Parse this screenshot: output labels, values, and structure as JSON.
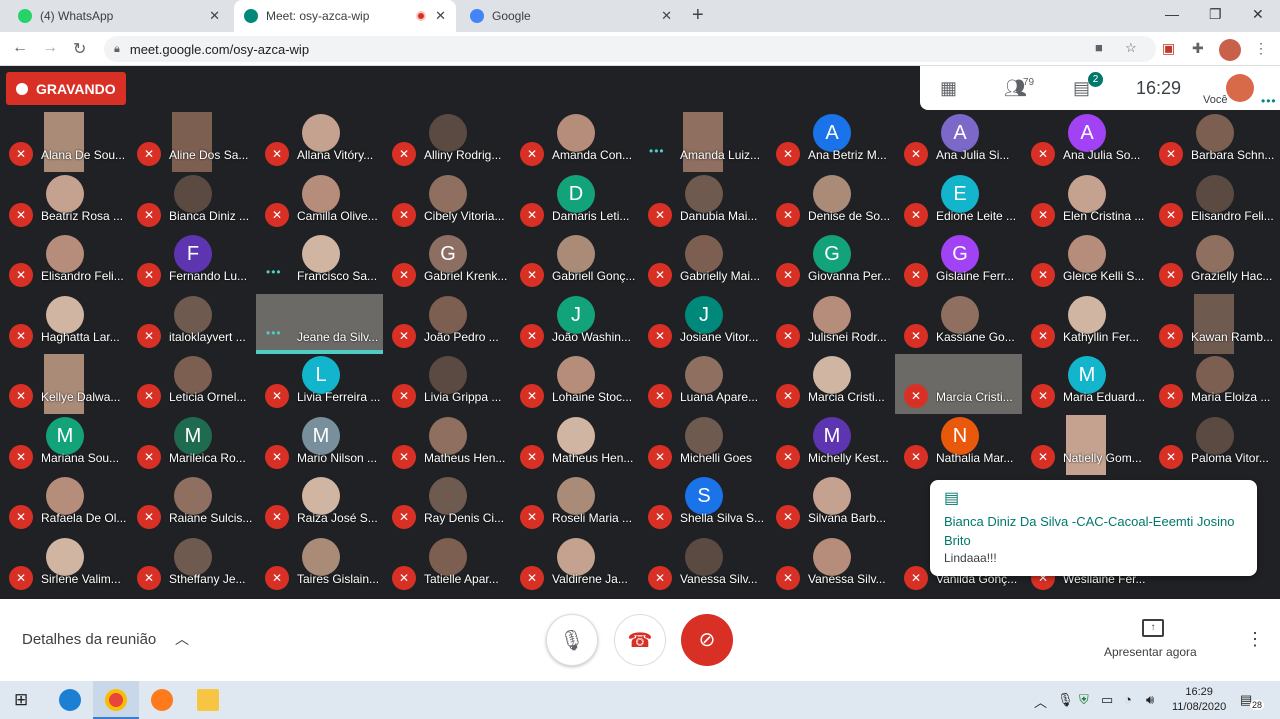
{
  "browser": {
    "tabs": [
      {
        "title": "(4) WhatsApp",
        "color": "#25d366"
      },
      {
        "title": "Meet: osy-azca-wip",
        "color": "#00897b"
      },
      {
        "title": "Google",
        "color": "#4285f4"
      }
    ],
    "url": "meet.google.com/osy-azca-wip"
  },
  "meet": {
    "recording_label": "GRAVANDO",
    "participants_count": "79",
    "chat_badge": "2",
    "clock": "16:29",
    "you_label": "Você",
    "participants": [
      {
        "name": "Alana De Sou...",
        "type": "video"
      },
      {
        "name": "Aline Dos Sa...",
        "type": "video"
      },
      {
        "name": "Allana Vitóry...",
        "type": "photo"
      },
      {
        "name": "Alliny Rodrig...",
        "type": "photo"
      },
      {
        "name": "Amanda Con...",
        "type": "photo"
      },
      {
        "name": "Amanda Luiz...",
        "type": "video",
        "speaking_dots": true
      },
      {
        "name": "Ana Betriz M...",
        "letter": "A",
        "color": "#1a73e8"
      },
      {
        "name": "Ana Julia Si...",
        "letter": "A",
        "color": "#7b68c8"
      },
      {
        "name": "Ana Julia So...",
        "letter": "A",
        "color": "#a142f4"
      },
      {
        "name": "Barbara Schn...",
        "type": "photo"
      },
      {
        "name": "Beatriz Rosa ...",
        "type": "photo"
      },
      {
        "name": "Bianca Diniz ...",
        "type": "photo"
      },
      {
        "name": "Camilla Olive...",
        "type": "photo"
      },
      {
        "name": "Cibely Vitoria...",
        "type": "photo"
      },
      {
        "name": "Damaris Leti...",
        "letter": "D",
        "color": "#12a37a"
      },
      {
        "name": "Danubia Mai...",
        "type": "photo"
      },
      {
        "name": "Denise de So...",
        "type": "photo"
      },
      {
        "name": "Edione Leite ...",
        "letter": "E",
        "color": "#12b5cb"
      },
      {
        "name": "Elen Cristina ...",
        "type": "photo"
      },
      {
        "name": "Elisandro Feli...",
        "type": "photo"
      },
      {
        "name": "Elisandro Feli...",
        "type": "photo"
      },
      {
        "name": "Fernando Lu...",
        "letter": "F",
        "color": "#5e35b1"
      },
      {
        "name": "Francisco Sa...",
        "type": "photo",
        "speaking_dots": true
      },
      {
        "name": "Gabriel Krenk...",
        "letter": "G",
        "color": "#8d6e63"
      },
      {
        "name": "Gabriell Gonç...",
        "type": "photo"
      },
      {
        "name": "Gabrielly Mai...",
        "type": "photo"
      },
      {
        "name": "Giovanna Per...",
        "letter": "G",
        "color": "#12a37a"
      },
      {
        "name": "Gislaine Ferr...",
        "letter": "G",
        "color": "#a142f4"
      },
      {
        "name": "Gleice Kelli S...",
        "type": "photo"
      },
      {
        "name": "Grazielly Hac...",
        "type": "photo"
      },
      {
        "name": "Haghatta Lar...",
        "type": "photo"
      },
      {
        "name": "italoklayvert ...",
        "type": "photo"
      },
      {
        "name": "Jeane da Silv...",
        "type": "video2",
        "speaking": true,
        "speaking_dots": true
      },
      {
        "name": "João Pedro ...",
        "type": "photo"
      },
      {
        "name": "João Washin...",
        "letter": "J",
        "color": "#12a37a"
      },
      {
        "name": "Josiane Vitor...",
        "letter": "J",
        "color": "#00897b"
      },
      {
        "name": "Julisnei Rodr...",
        "type": "photo"
      },
      {
        "name": "Kassiane Go...",
        "type": "photo"
      },
      {
        "name": "Kathyllin Fer...",
        "type": "photo"
      },
      {
        "name": "Kawan Ramb...",
        "type": "video"
      },
      {
        "name": "Kellye Dalwa...",
        "type": "video"
      },
      {
        "name": "Leticia Ornel...",
        "type": "photo"
      },
      {
        "name": "Livia Ferreira ...",
        "letter": "L",
        "color": "#12b5cb"
      },
      {
        "name": "Livia Grippa ...",
        "type": "photo"
      },
      {
        "name": "Lohaine Stoc...",
        "type": "photo"
      },
      {
        "name": "Luana Apare...",
        "type": "photo"
      },
      {
        "name": "Marcia Cristi...",
        "type": "photo"
      },
      {
        "name": "Marcia Cristi...",
        "type": "video2"
      },
      {
        "name": "Maria Eduard...",
        "letter": "M",
        "color": "#12b5cb"
      },
      {
        "name": "Maria Eloiza ...",
        "type": "photo"
      },
      {
        "name": "Mariana Sou...",
        "letter": "M",
        "color": "#12a37a"
      },
      {
        "name": "Marileica Ro...",
        "letter": "M",
        "color": "#1e6b4f"
      },
      {
        "name": "Mario Nilson ...",
        "letter": "M",
        "color": "#78909c"
      },
      {
        "name": "Matheus Hen...",
        "type": "photo"
      },
      {
        "name": "Matheus Hen...",
        "type": "photo"
      },
      {
        "name": "Michelli Goes",
        "type": "photo"
      },
      {
        "name": "Michelly Kest...",
        "letter": "M",
        "color": "#5e35b1"
      },
      {
        "name": "Nathalia Mar...",
        "letter": "N",
        "color": "#e8590c"
      },
      {
        "name": "Natielly Gom...",
        "type": "video"
      },
      {
        "name": "Paloma Vitor...",
        "type": "photo"
      },
      {
        "name": "Rafaela De Ol...",
        "type": "photo"
      },
      {
        "name": "Raiane Sulcis...",
        "type": "photo"
      },
      {
        "name": "Raiza José S...",
        "type": "photo"
      },
      {
        "name": "Ray Denis Ci...",
        "type": "photo"
      },
      {
        "name": "Roseli Maria ...",
        "type": "photo"
      },
      {
        "name": "Shella Silva S...",
        "letter": "S",
        "color": "#1a73e8"
      },
      {
        "name": "Silvana Barb...",
        "type": "photo"
      },
      {
        "name": "",
        "type": "hidden"
      },
      {
        "name": "",
        "type": "hidden"
      },
      {
        "name": "",
        "type": "hidden"
      },
      {
        "name": "Sirlene Valim...",
        "type": "photo"
      },
      {
        "name": "Stheffany Je...",
        "type": "photo"
      },
      {
        "name": "Taires Gislain...",
        "type": "photo"
      },
      {
        "name": "Tatielle Apar...",
        "type": "photo"
      },
      {
        "name": "Valdirene Ja...",
        "type": "photo"
      },
      {
        "name": "Vanessa Silv...",
        "type": "photo"
      },
      {
        "name": "Vanessa Silv...",
        "type": "photo"
      },
      {
        "name": "Vanilda Gonç...",
        "type": "photo"
      },
      {
        "name": "Wesllaine Fer...",
        "type": "photo"
      },
      {
        "name": "",
        "type": "hidden"
      }
    ]
  },
  "chat_popup": {
    "sender": "Bianca Diniz Da Silva -CAC-Cacoal-Eeemti Josino Brito",
    "message": "Lindaaa!!!"
  },
  "bottom": {
    "details_label": "Detalhes da reunião",
    "present_label": "Apresentar agora"
  },
  "taskbar": {
    "time": "16:29",
    "date": "11/08/2020",
    "notifications": "28"
  },
  "colors": {
    "accent": "#00897b",
    "mute_red": "#d93025",
    "bg": "#202124"
  }
}
